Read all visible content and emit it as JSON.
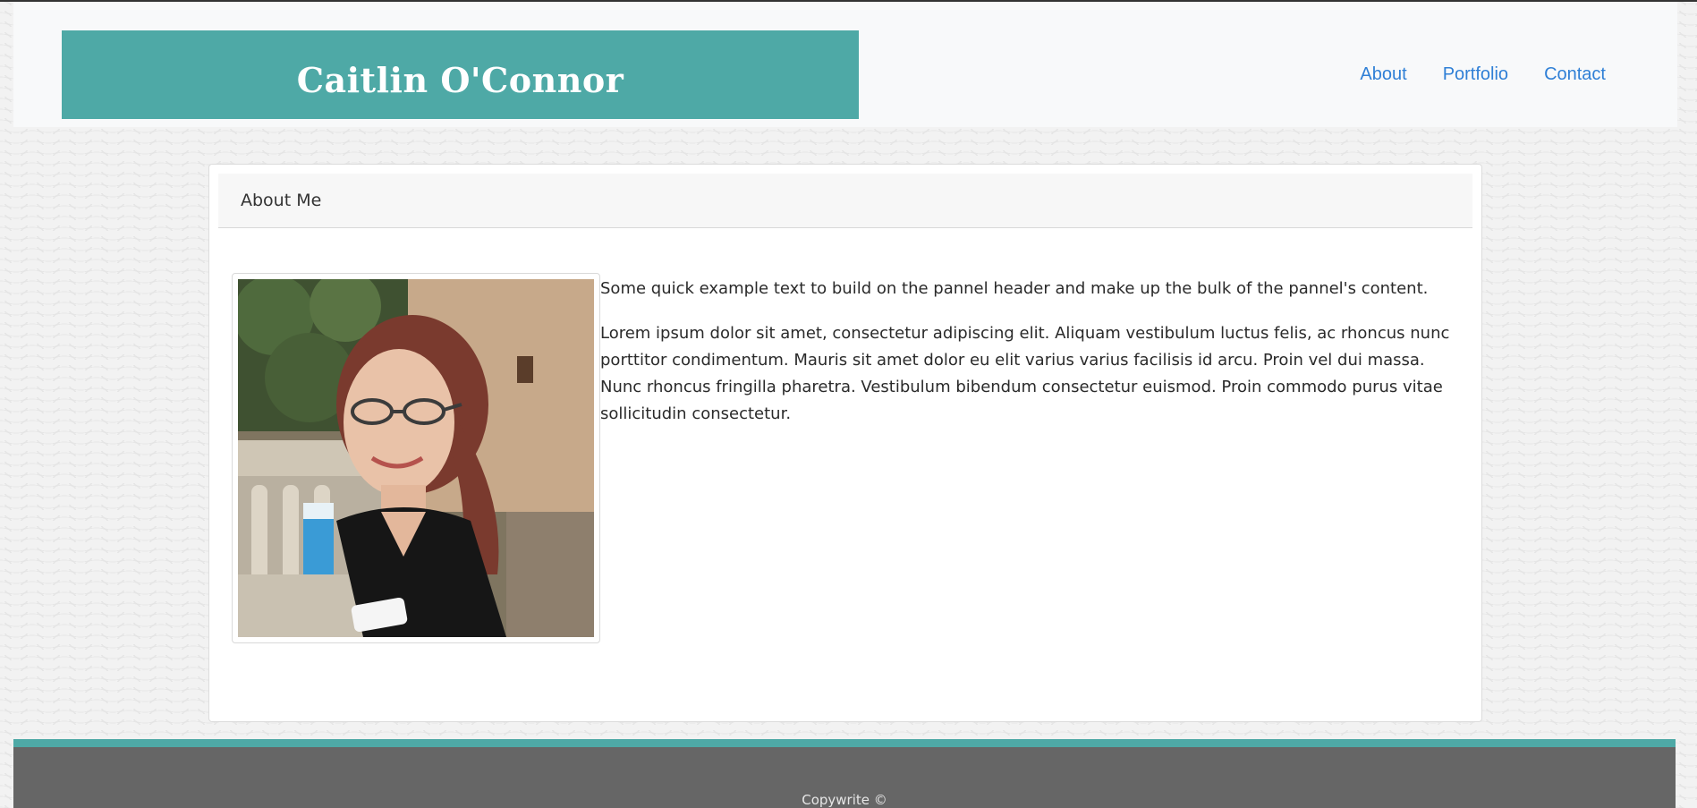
{
  "header": {
    "brand": "Caitlin O'Connor",
    "nav": [
      {
        "label": "About"
      },
      {
        "label": "Portfolio"
      },
      {
        "label": "Contact"
      }
    ]
  },
  "about": {
    "title": "About Me",
    "intro": "Some quick example text to build on the pannel header and make up the bulk of the pannel's content.",
    "body": "Lorem ipsum dolor sit amet, consectetur adipiscing elit. Aliquam vestibulum luctus felis, ac rhoncus nunc porttitor condimentum. Mauris sit amet dolor eu elit varius varius facilisis id arcu. Proin vel dui massa. Nunc rhoncus fringilla pharetra. Vestibulum bibendum consectetur euismod. Proin commodo purus vitae sollicitudin consectetur."
  },
  "footer": {
    "text": "Copywrite ©"
  },
  "colors": {
    "accent": "#4ea9a6",
    "link": "#2f7fd6",
    "footer_bg": "#666666"
  }
}
